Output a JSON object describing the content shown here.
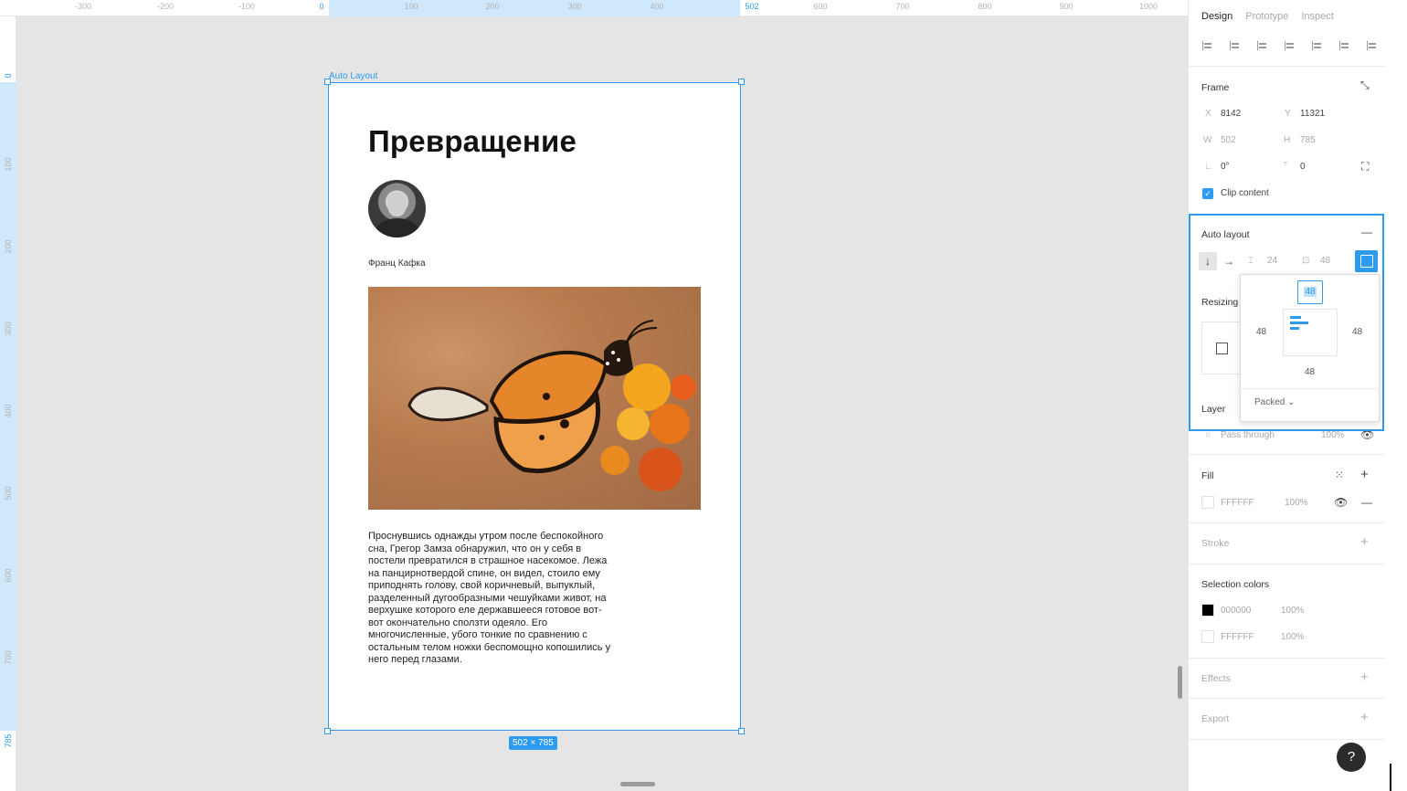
{
  "ruler": {
    "top_ticks": [
      "-300",
      "-200",
      "-100",
      "0",
      "100",
      "200",
      "300",
      "400",
      "502",
      "600",
      "700",
      "800",
      "900",
      "1000"
    ],
    "left_ticks": [
      "0",
      "100",
      "200",
      "300",
      "400",
      "500",
      "600",
      "700",
      "785"
    ]
  },
  "canvas": {
    "frame_label": "Auto Layout",
    "title": "Превращение",
    "author": "Франц Кафка",
    "body": "Проснувшись однажды утром после беспокойного сна, Грегор Замза обнаружил, что он у себя в постели превратился в страшное насекомое. Лежа на панцирнотвердой спине, он видел, стоило ему приподнять голову, свой коричневый, выпуклый, разделенный дугообразными чешуйками живот, на верхушке которого еле державшееся готовое вот-вот окончательно сползти одеяло. Его многочисленные, убого тонкие по сравнению с остальным телом ножки беспомощно копошились у него перед глазами.",
    "size_badge": "502 × 785"
  },
  "panel": {
    "tabs": [
      "Design",
      "Prototype",
      "Inspect"
    ],
    "frame": {
      "title": "Frame",
      "x_label": "X",
      "x": "8142",
      "y_label": "Y",
      "y": "11321",
      "w_label": "W",
      "w": "502",
      "h_label": "H",
      "h": "785",
      "rotation": "0°",
      "radius": "0",
      "clip_content": "Clip content"
    },
    "auto_layout": {
      "title": "Auto layout",
      "spacing": "24",
      "padding": "48"
    },
    "padding_popover": {
      "top": "48",
      "left": "48",
      "right": "48",
      "bottom": "48",
      "distribution": "Packed"
    },
    "resizing": {
      "title": "Resizing"
    },
    "layer": {
      "title": "Layer",
      "blend": "Pass through",
      "opacity": "100%"
    },
    "fill": {
      "title": "Fill",
      "hex": "FFFFFF",
      "opacity": "100%"
    },
    "stroke": {
      "title": "Stroke"
    },
    "selection_colors": {
      "title": "Selection colors",
      "items": [
        {
          "hex": "000000",
          "opacity": "100%",
          "color": "#000000"
        },
        {
          "hex": "FFFFFF",
          "opacity": "100%",
          "color": "#FFFFFF"
        }
      ]
    },
    "effects": {
      "title": "Effects"
    },
    "export": {
      "title": "Export"
    }
  },
  "help": "?",
  "colors": {
    "accent": "#2c9bf0",
    "canvas": "#e5e5e5"
  }
}
